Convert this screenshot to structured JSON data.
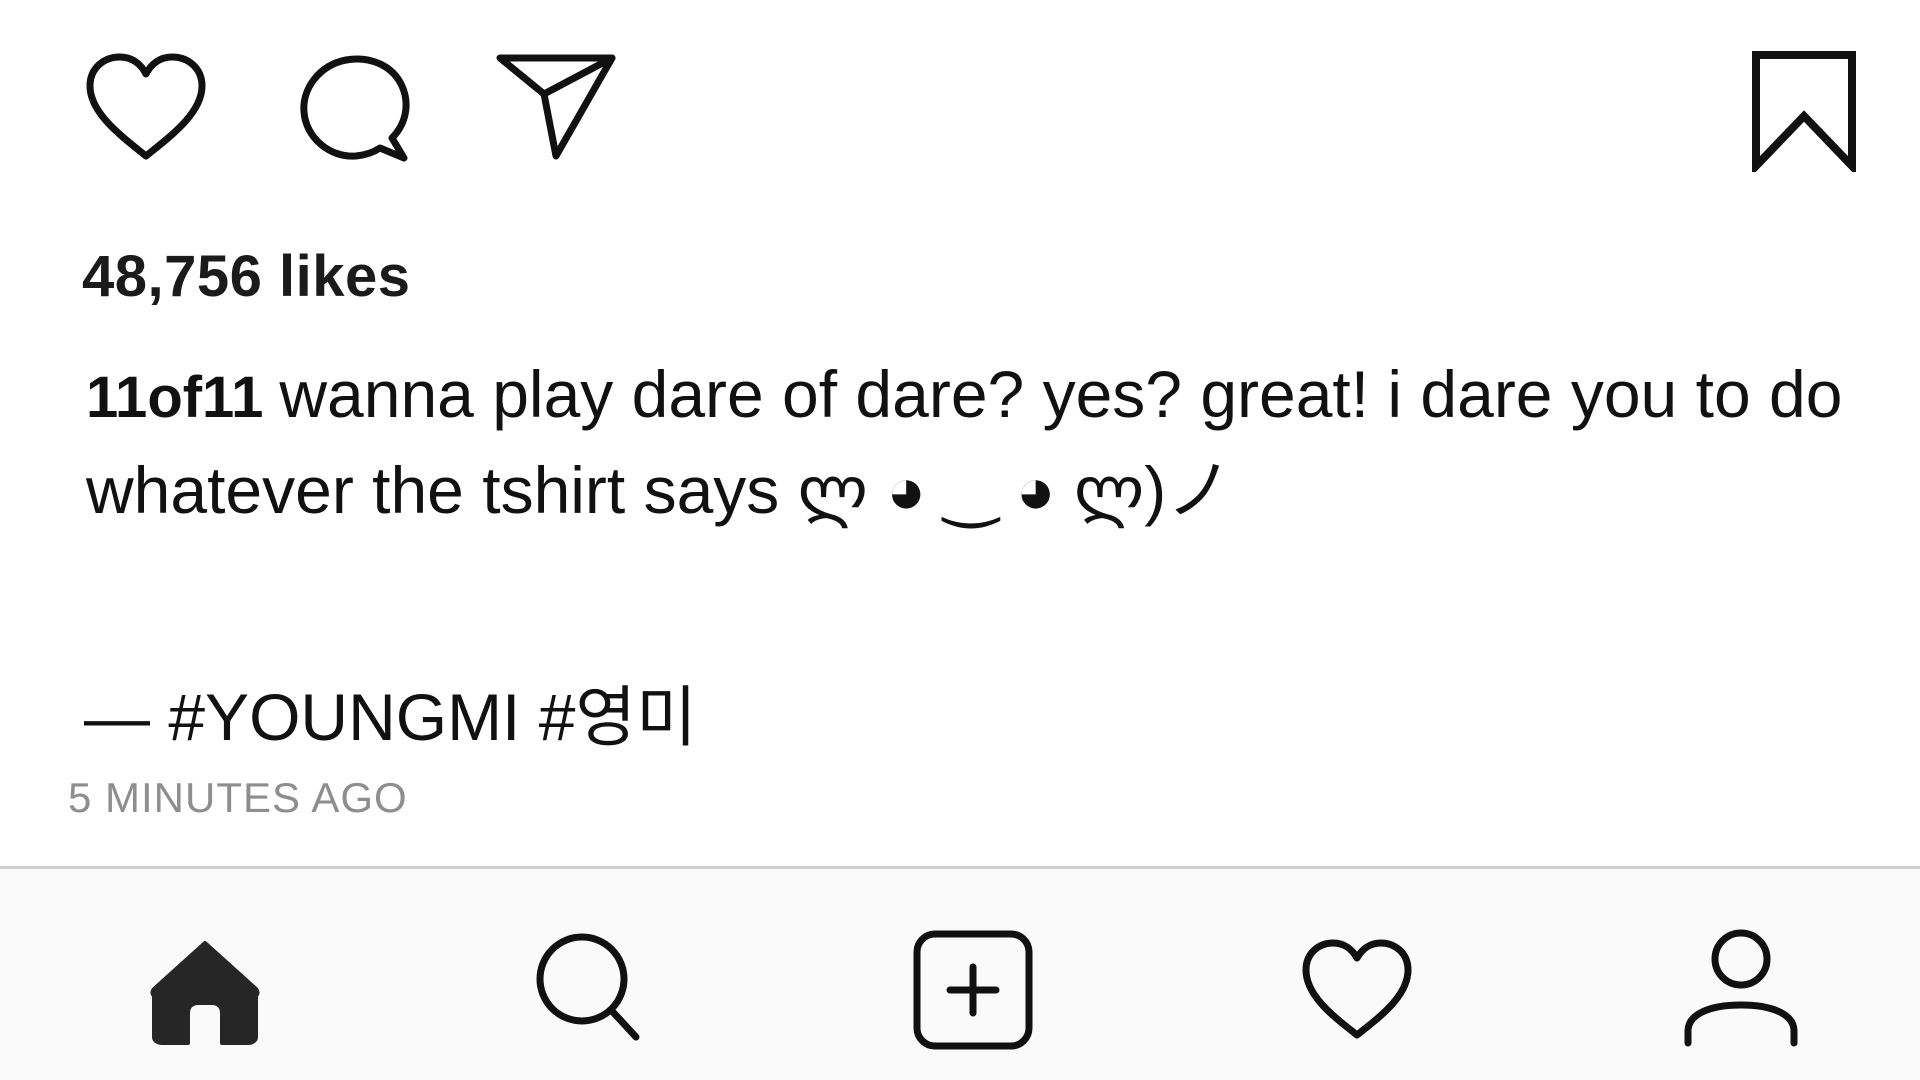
{
  "post": {
    "likes_text": "48,756 likes",
    "username": "11of11",
    "caption": "wanna play dare of dare? yes? great! i dare you to do whatever the tshirt says ლ ◕ ‿ ◕ ლ)ノ",
    "hashtags": "— #YOUNGMI #영미",
    "timestamp": "5 MINUTES AGO"
  },
  "actions": [
    {
      "name": "like",
      "icon": "heart-outline-icon"
    },
    {
      "name": "comment",
      "icon": "comment-bubble-icon"
    },
    {
      "name": "share",
      "icon": "paper-plane-icon"
    },
    {
      "name": "save",
      "icon": "bookmark-icon"
    }
  ],
  "tab_bar": [
    {
      "name": "home",
      "icon": "home-filled-icon",
      "active": true
    },
    {
      "name": "search",
      "icon": "search-icon",
      "active": false
    },
    {
      "name": "new-post",
      "icon": "add-square-icon",
      "active": false
    },
    {
      "name": "activity",
      "icon": "heart-outline-icon",
      "active": false
    },
    {
      "name": "profile",
      "icon": "person-icon",
      "active": false
    }
  ],
  "colors": {
    "text": "#111111",
    "timestamp": "#8e8e8e",
    "tab_background": "#fafafa",
    "divider": "#cfcfcf"
  }
}
